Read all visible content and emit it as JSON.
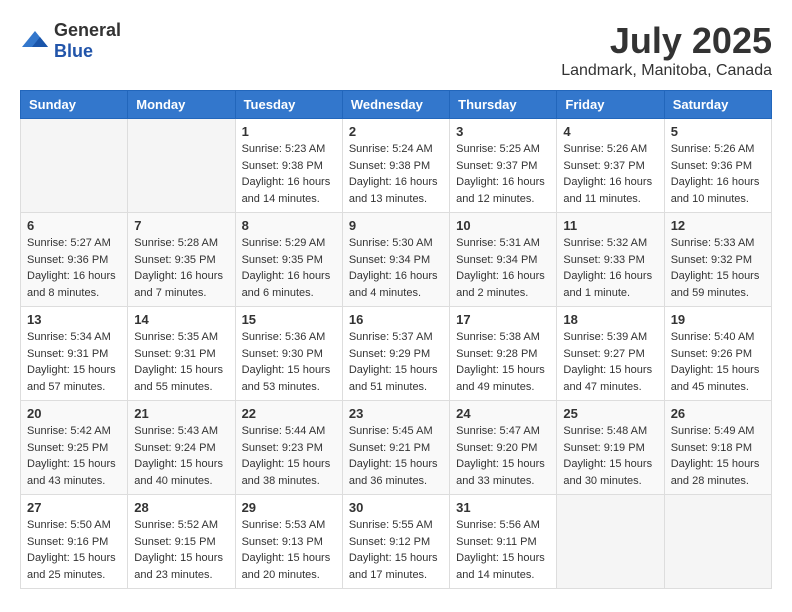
{
  "header": {
    "logo_general": "General",
    "logo_blue": "Blue",
    "month_year": "July 2025",
    "location": "Landmark, Manitoba, Canada"
  },
  "weekdays": [
    "Sunday",
    "Monday",
    "Tuesday",
    "Wednesday",
    "Thursday",
    "Friday",
    "Saturday"
  ],
  "weeks": [
    [
      {
        "day": "",
        "info": ""
      },
      {
        "day": "",
        "info": ""
      },
      {
        "day": "1",
        "info": "Sunrise: 5:23 AM\nSunset: 9:38 PM\nDaylight: 16 hours and 14 minutes."
      },
      {
        "day": "2",
        "info": "Sunrise: 5:24 AM\nSunset: 9:38 PM\nDaylight: 16 hours and 13 minutes."
      },
      {
        "day": "3",
        "info": "Sunrise: 5:25 AM\nSunset: 9:37 PM\nDaylight: 16 hours and 12 minutes."
      },
      {
        "day": "4",
        "info": "Sunrise: 5:26 AM\nSunset: 9:37 PM\nDaylight: 16 hours and 11 minutes."
      },
      {
        "day": "5",
        "info": "Sunrise: 5:26 AM\nSunset: 9:36 PM\nDaylight: 16 hours and 10 minutes."
      }
    ],
    [
      {
        "day": "6",
        "info": "Sunrise: 5:27 AM\nSunset: 9:36 PM\nDaylight: 16 hours and 8 minutes."
      },
      {
        "day": "7",
        "info": "Sunrise: 5:28 AM\nSunset: 9:35 PM\nDaylight: 16 hours and 7 minutes."
      },
      {
        "day": "8",
        "info": "Sunrise: 5:29 AM\nSunset: 9:35 PM\nDaylight: 16 hours and 6 minutes."
      },
      {
        "day": "9",
        "info": "Sunrise: 5:30 AM\nSunset: 9:34 PM\nDaylight: 16 hours and 4 minutes."
      },
      {
        "day": "10",
        "info": "Sunrise: 5:31 AM\nSunset: 9:34 PM\nDaylight: 16 hours and 2 minutes."
      },
      {
        "day": "11",
        "info": "Sunrise: 5:32 AM\nSunset: 9:33 PM\nDaylight: 16 hours and 1 minute."
      },
      {
        "day": "12",
        "info": "Sunrise: 5:33 AM\nSunset: 9:32 PM\nDaylight: 15 hours and 59 minutes."
      }
    ],
    [
      {
        "day": "13",
        "info": "Sunrise: 5:34 AM\nSunset: 9:31 PM\nDaylight: 15 hours and 57 minutes."
      },
      {
        "day": "14",
        "info": "Sunrise: 5:35 AM\nSunset: 9:31 PM\nDaylight: 15 hours and 55 minutes."
      },
      {
        "day": "15",
        "info": "Sunrise: 5:36 AM\nSunset: 9:30 PM\nDaylight: 15 hours and 53 minutes."
      },
      {
        "day": "16",
        "info": "Sunrise: 5:37 AM\nSunset: 9:29 PM\nDaylight: 15 hours and 51 minutes."
      },
      {
        "day": "17",
        "info": "Sunrise: 5:38 AM\nSunset: 9:28 PM\nDaylight: 15 hours and 49 minutes."
      },
      {
        "day": "18",
        "info": "Sunrise: 5:39 AM\nSunset: 9:27 PM\nDaylight: 15 hours and 47 minutes."
      },
      {
        "day": "19",
        "info": "Sunrise: 5:40 AM\nSunset: 9:26 PM\nDaylight: 15 hours and 45 minutes."
      }
    ],
    [
      {
        "day": "20",
        "info": "Sunrise: 5:42 AM\nSunset: 9:25 PM\nDaylight: 15 hours and 43 minutes."
      },
      {
        "day": "21",
        "info": "Sunrise: 5:43 AM\nSunset: 9:24 PM\nDaylight: 15 hours and 40 minutes."
      },
      {
        "day": "22",
        "info": "Sunrise: 5:44 AM\nSunset: 9:23 PM\nDaylight: 15 hours and 38 minutes."
      },
      {
        "day": "23",
        "info": "Sunrise: 5:45 AM\nSunset: 9:21 PM\nDaylight: 15 hours and 36 minutes."
      },
      {
        "day": "24",
        "info": "Sunrise: 5:47 AM\nSunset: 9:20 PM\nDaylight: 15 hours and 33 minutes."
      },
      {
        "day": "25",
        "info": "Sunrise: 5:48 AM\nSunset: 9:19 PM\nDaylight: 15 hours and 30 minutes."
      },
      {
        "day": "26",
        "info": "Sunrise: 5:49 AM\nSunset: 9:18 PM\nDaylight: 15 hours and 28 minutes."
      }
    ],
    [
      {
        "day": "27",
        "info": "Sunrise: 5:50 AM\nSunset: 9:16 PM\nDaylight: 15 hours and 25 minutes."
      },
      {
        "day": "28",
        "info": "Sunrise: 5:52 AM\nSunset: 9:15 PM\nDaylight: 15 hours and 23 minutes."
      },
      {
        "day": "29",
        "info": "Sunrise: 5:53 AM\nSunset: 9:13 PM\nDaylight: 15 hours and 20 minutes."
      },
      {
        "day": "30",
        "info": "Sunrise: 5:55 AM\nSunset: 9:12 PM\nDaylight: 15 hours and 17 minutes."
      },
      {
        "day": "31",
        "info": "Sunrise: 5:56 AM\nSunset: 9:11 PM\nDaylight: 15 hours and 14 minutes."
      },
      {
        "day": "",
        "info": ""
      },
      {
        "day": "",
        "info": ""
      }
    ]
  ]
}
